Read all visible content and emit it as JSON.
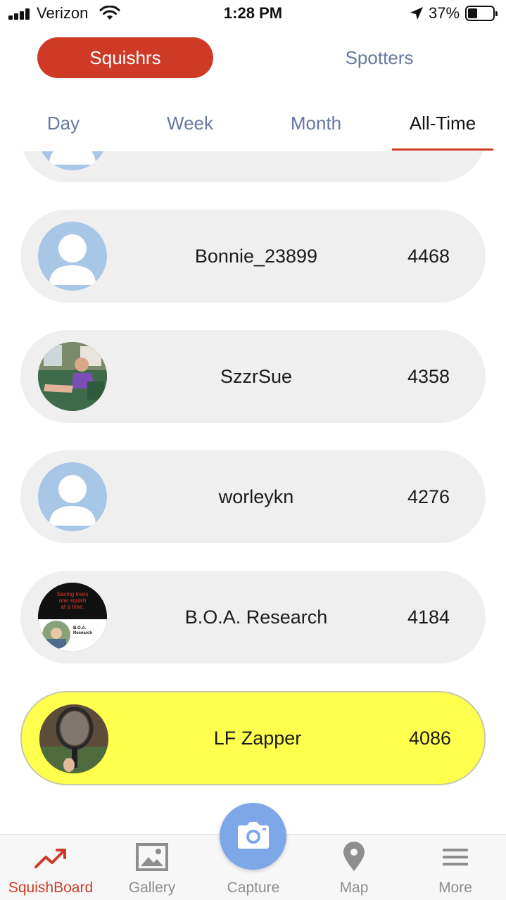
{
  "status_bar": {
    "carrier": "Verizon",
    "time": "1:28 PM",
    "battery_percent": "37%",
    "battery_level": 0.37
  },
  "segments": {
    "active_label": "Squishrs",
    "inactive_label": "Spotters",
    "active_color": "#cf3a27"
  },
  "period_tabs": [
    {
      "label": "Day",
      "selected": false
    },
    {
      "label": "Week",
      "selected": false
    },
    {
      "label": "Month",
      "selected": false
    },
    {
      "label": "All-Time",
      "selected": true
    }
  ],
  "leaderboard": [
    {
      "name": "Bonnie_23899",
      "score": "4468",
      "avatar": "default-avatar"
    },
    {
      "name": "SzzrSue",
      "score": "4358",
      "avatar": "photo-avatar"
    },
    {
      "name": "worleykn",
      "score": "4276",
      "avatar": "default-avatar"
    },
    {
      "name": "B.O.A. Research",
      "score": "4184",
      "avatar": "boa-logo-avatar",
      "avatar_text": "Saving trees one squish at a time.",
      "avatar_subtext": "B.O.A. Research"
    },
    {
      "name": "LF Zapper",
      "score": "4086",
      "avatar": "zapper-photo-avatar",
      "highlighted": true
    }
  ],
  "highlight_color": "#ffff4d",
  "tab_bar": {
    "items": [
      {
        "label": "SquishBoard",
        "icon": "trending-up-icon",
        "active": true
      },
      {
        "label": "Gallery",
        "icon": "image-icon",
        "active": false
      },
      {
        "label": "Capture",
        "icon": "camera-icon",
        "active": false
      },
      {
        "label": "Map",
        "icon": "map-pin-icon",
        "active": false
      },
      {
        "label": "More",
        "icon": "menu-icon",
        "active": false
      }
    ]
  }
}
